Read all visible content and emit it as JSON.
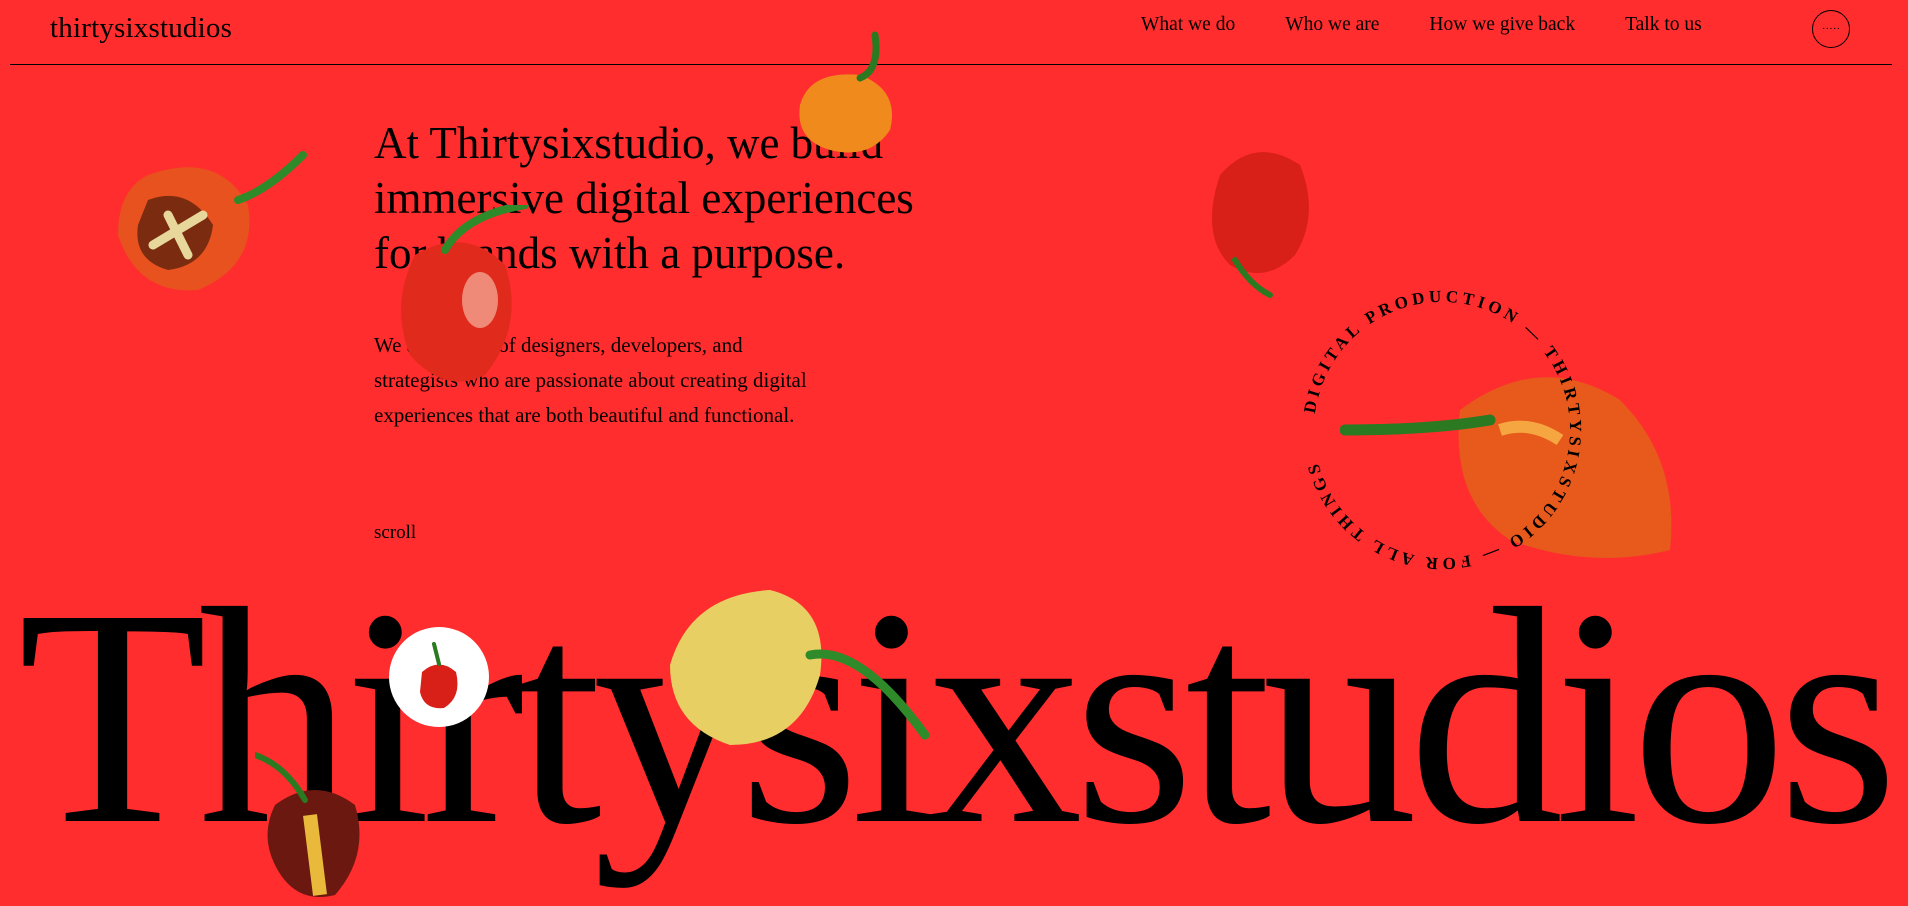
{
  "header": {
    "logo": "thirtysixstudios",
    "nav": [
      "What we do",
      "Who we are",
      "How we give back",
      "Talk to us"
    ],
    "menu_glyph": "·····"
  },
  "hero": {
    "headline": "At Thirtysixstudio, we build immersive digital experiences for brands with a purpose.",
    "intro": "We are a team of designers, developers, and strategists who are passionate about creating digital experiences that are both beautiful and functional.",
    "scroll_label": "scroll"
  },
  "badge": {
    "text": "DIGITAL PRODUCTION — THIRTYSIXSTUDIO — FOR ALL THINGS"
  },
  "wordmark": "Thirtysixstudios",
  "colors": {
    "background": "#ff2d2d",
    "text": "#000000"
  }
}
